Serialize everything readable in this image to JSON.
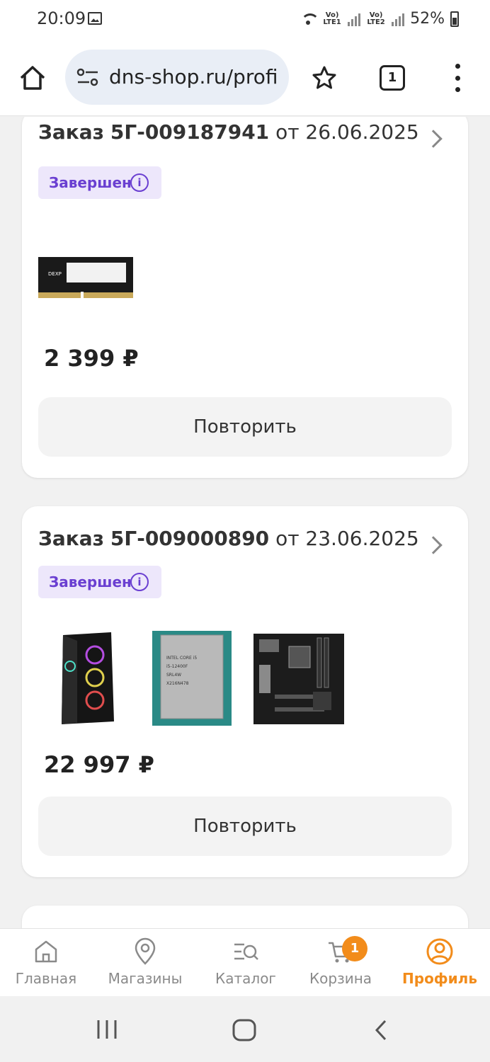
{
  "status_bar": {
    "time": "20:09",
    "network_1": "Vo) LTE1",
    "network_2": "Vo) LTE2",
    "battery": "52%"
  },
  "browser": {
    "url": "dns-shop.ru/profi",
    "tab_count": "1"
  },
  "orders": [
    {
      "label": "Заказ",
      "number": "5Г-009187941",
      "date_text": "от 26.06.2025",
      "status": "Завершен",
      "status_info_icon": "i",
      "price": "2 399 ₽",
      "repeat_label": "Повторить",
      "products": [
        "ram-module"
      ]
    },
    {
      "label": "Заказ",
      "number": "5Г-009000890",
      "date_text": "от 23.06.2025",
      "status": "Завершен",
      "status_info_icon": "i",
      "price": "22 997 ₽",
      "repeat_label": "Повторить",
      "products": [
        "pc-case",
        "cpu",
        "motherboard"
      ]
    }
  ],
  "bottom_nav": {
    "items": [
      {
        "label": "Главная",
        "icon": "home-icon"
      },
      {
        "label": "Магазины",
        "icon": "location-pin-icon"
      },
      {
        "label": "Каталог",
        "icon": "catalog-search-icon"
      },
      {
        "label": "Корзина",
        "icon": "cart-icon"
      },
      {
        "label": "Профиль",
        "icon": "profile-icon"
      }
    ],
    "cart_count": "1",
    "active": "Профиль"
  },
  "colors": {
    "accent": "#f28c1b",
    "status_purple": "#6a3fd1",
    "badge_bg": "#ede7fb"
  }
}
